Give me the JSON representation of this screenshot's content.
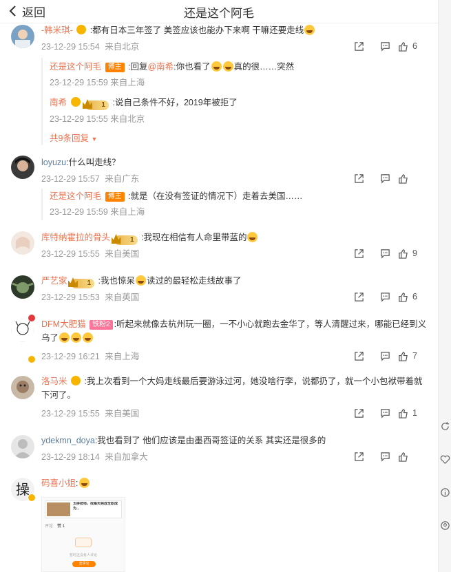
{
  "header": {
    "back_label": "返回",
    "title": "还是这个阿毛"
  },
  "comments": [
    {
      "user": "-韩米琪-",
      "text": ":都有日本三年签了 美签应该也能办下来啊 干嘛还要走线",
      "time": "23-12-29 15:54",
      "source": "来自北京",
      "likes": "6",
      "replies": [
        {
          "user": "还是这个阿毛",
          "tag": "博主",
          "text": ":回复",
          "mention": "@南希",
          "text2": ":你也看了",
          "text3": "真的很……突然",
          "time": "23-12-29 15:59",
          "source": "来自上海"
        },
        {
          "user": "南希",
          "level": "1",
          "text": ":说自己条件不好，2019年被拒了",
          "time": "23-12-29 15:55",
          "source": "来自北京"
        }
      ],
      "more": "共9条回复"
    },
    {
      "user": "loyuzu",
      "text": ":什么叫走线？",
      "time": "23-12-29 15:57",
      "source": "来自广东",
      "likes": "",
      "replies": [
        {
          "user": "还是这个阿毛",
          "tag": "博主",
          "text": ":就是（在没有签证的情况下）走着去美国……",
          "time": "23-12-29 15:59",
          "source": "来自上海"
        }
      ]
    },
    {
      "user": "库特纳霍拉的骨头",
      "level": "1",
      "text": ":我现在相信有人命里带蓝的",
      "time": "23-12-29 15:55",
      "source": "来自美国",
      "likes": "9"
    },
    {
      "user": "严艺家",
      "level": "1",
      "text": ":我也惊呆",
      "text2": "读过的最轻松走线故事了",
      "time": "23-12-29 15:53",
      "source": "来自英国",
      "likes": "6"
    },
    {
      "user": "DFM大肥猫",
      "tag": "铁粉2",
      "text": ":听起来就像去杭州玩一圈，一不小心就跑去金华了，等人清醒过来，哪能已经到义乌了",
      "time": "23-12-29 16:21",
      "source": "来自上海",
      "likes": "7"
    },
    {
      "user": "洛马米",
      "text": ":我上次看到一个大妈走线最后要游泳过河，她没啥行李，说都扔了，就一个小包袱带着就下河了。",
      "time": "23-12-29 15:55",
      "source": "来自美国",
      "likes": "1"
    },
    {
      "user": "ydekmn_doya",
      "text": ":我也看到了 他们应该是由墨西哥签证的关系 其实还是很多的",
      "time": "23-12-29 18:14",
      "source": "来自加拿大",
      "likes": ""
    },
    {
      "user": "码喜小姐",
      "text": ":",
      "thumbnail": {
        "headline": "太拼技师，找每天完成全职成为...",
        "tab1": "评论",
        "tab2": "赞 1",
        "empty_text": "暂时还没有人评论",
        "button": "去评论"
      }
    }
  ],
  "colors": {
    "accent": "#eb7350",
    "brand_orange": "#ff8200"
  }
}
